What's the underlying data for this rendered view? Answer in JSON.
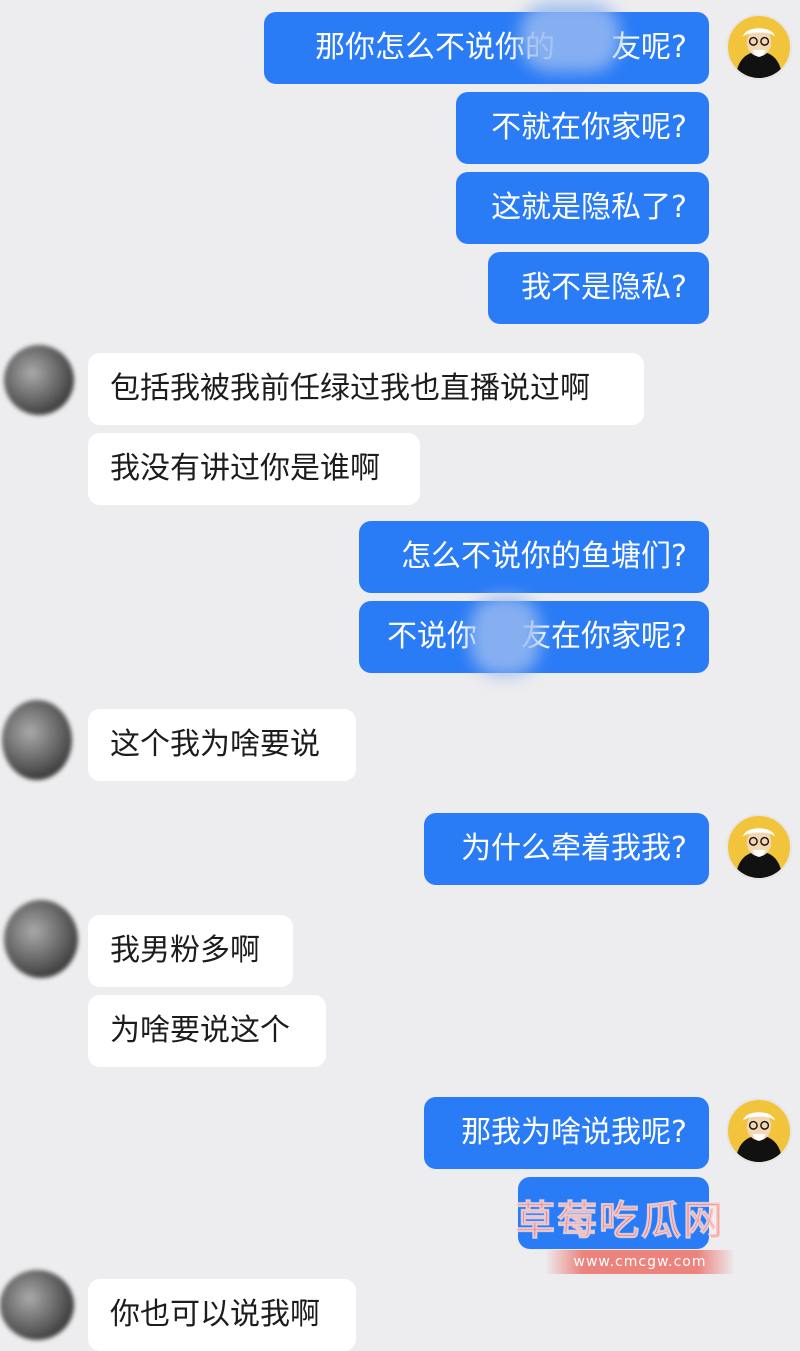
{
  "messages": [
    {
      "side": "sent",
      "text": "那你怎么不说你的",
      "text_after_blur": "友呢?"
    },
    {
      "side": "sent",
      "text": "不就在你家呢?"
    },
    {
      "side": "sent",
      "text": "这就是隐私了?"
    },
    {
      "side": "sent",
      "text": "我不是隐私?"
    },
    {
      "side": "recv",
      "text": "包括我被我前任绿过我也直播说过啊"
    },
    {
      "side": "recv",
      "text": "我没有讲过你是谁啊"
    },
    {
      "side": "sent",
      "text": "怎么不说你的鱼塘们?"
    },
    {
      "side": "sent",
      "text": "不说你",
      "text_after_blur": "友在你家呢?"
    },
    {
      "side": "recv",
      "text": "这个我为啥要说"
    },
    {
      "side": "sent",
      "text": "为什么牵着我我?"
    },
    {
      "side": "recv",
      "text": "我男粉多啊"
    },
    {
      "side": "recv",
      "text": "为啥要说这个"
    },
    {
      "side": "sent",
      "text": "那我为啥说我呢?"
    },
    {
      "side": "sent",
      "text": ""
    },
    {
      "side": "recv",
      "text": "你也可以说我啊"
    }
  ],
  "watermark": {
    "title": "草莓吃瓜网",
    "url": "www.cmcgw.com"
  },
  "colors": {
    "background": "#ededef",
    "sent_bubble": "#2a7bf6",
    "recv_bubble": "#ffffff",
    "self_avatar": "#f2c43b"
  }
}
